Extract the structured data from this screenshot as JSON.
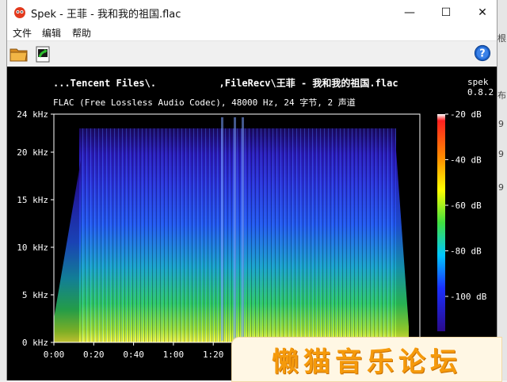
{
  "window": {
    "title": "Spek - 王菲 - 我和我的祖国.flac",
    "controls": {
      "minimize": "—",
      "maximize": "☐",
      "close": "✕"
    }
  },
  "menu": [
    "文件",
    "编辑",
    "帮助"
  ],
  "toolbar": {
    "open_icon": "open-folder-icon",
    "save_icon": "save-image-icon",
    "help_icon": "help-icon"
  },
  "header": {
    "title": "...Tencent Files\\.           ,FileRecv\\王菲 - 我和我的祖国.flac",
    "app_version": "spek 0.8.2",
    "info": "FLAC (Free Lossless Audio Codec), 48000 Hz, 24 字节, 2 声道"
  },
  "chart_data": {
    "type": "heatmap",
    "y_axis": {
      "unit": "kHz",
      "range": [
        0,
        24
      ],
      "ticks": [
        "0 kHz",
        "5 kHz",
        "10 kHz",
        "15 kHz",
        "20 kHz",
        "24 kHz"
      ]
    },
    "x_axis": {
      "ticks": [
        "0:00",
        "0:20",
        "0:40",
        "1:00",
        "1:20"
      ]
    },
    "color_scale": {
      "unit": "dB",
      "ticks": [
        "-20 dB",
        "-40 dB",
        "-60 dB",
        "-80 dB",
        "-100 dB"
      ]
    },
    "colors": {
      "low": "#000080",
      "mid_low": "#1e30ff",
      "mid": "#00c8c8",
      "mid_high": "#2fe02f",
      "high": "#ffff00"
    }
  },
  "watermark": "懒猫音乐论坛",
  "background": {
    "left_glyphs": [
      "°",
      "按"
    ],
    "right_glyphs": [
      "根",
      "布",
      "9",
      "9",
      "9"
    ]
  }
}
